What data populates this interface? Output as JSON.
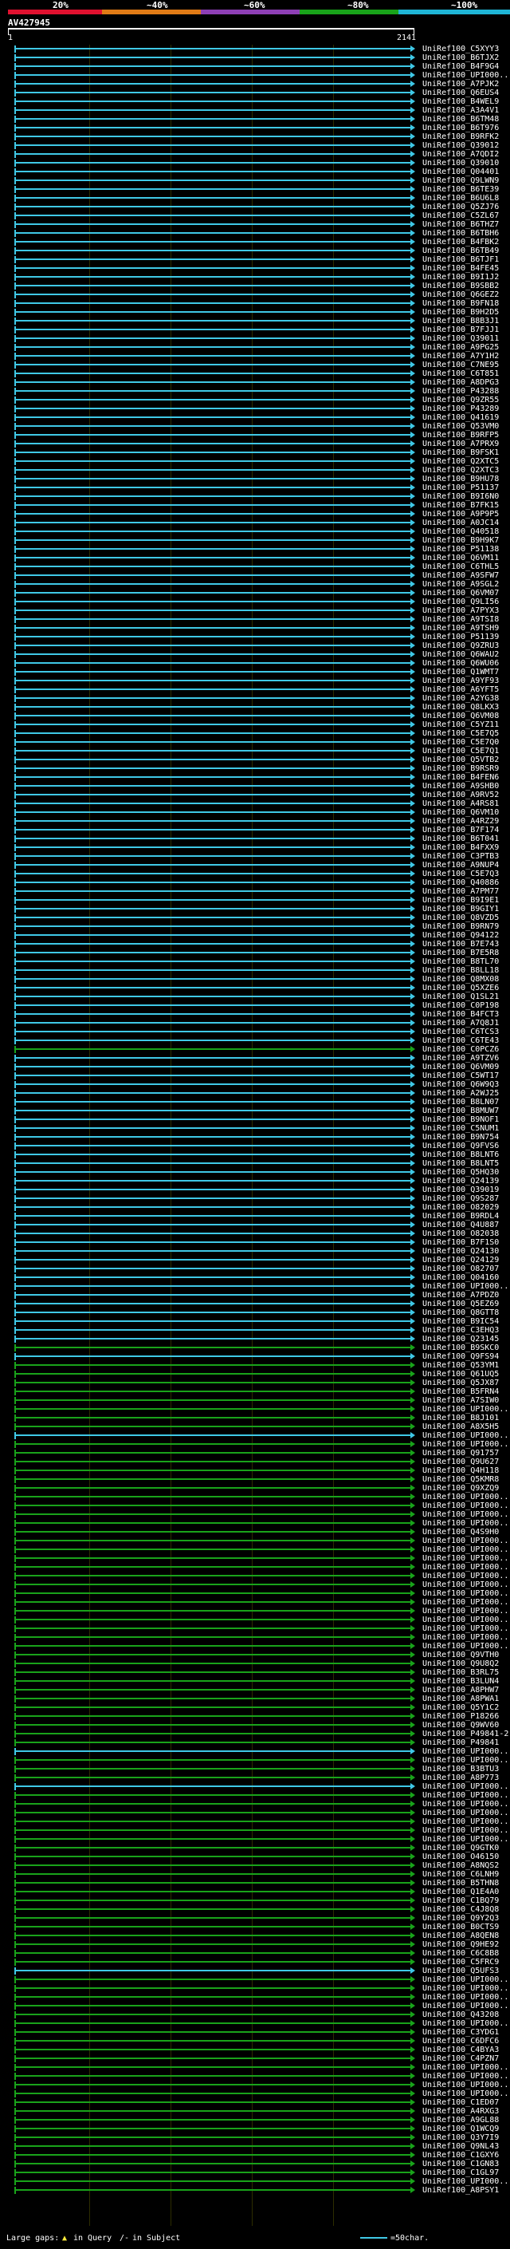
{
  "header": {
    "percent_labels": [
      "20%",
      "~40%",
      "~60%",
      "~80%",
      "~100%"
    ],
    "percent_colors": [
      "#e0112f",
      "#e07b16",
      "#8e3fb5",
      "#19a31a",
      "#1fb5d6"
    ],
    "query_name": "AV427945",
    "ruler_start": "1",
    "ruler_end": "2141"
  },
  "hits": [
    {
      "name": "UniRef100_C5XYY3",
      "color": "#3fc8e6"
    },
    {
      "name": "UniRef100_B6TJX2",
      "color": "#3fc8e6"
    },
    {
      "name": "UniRef100_B4F9G4",
      "color": "#3fc8e6"
    },
    {
      "name": "UniRef100_UPI000...",
      "color": "#3fc8e6"
    },
    {
      "name": "UniRef100_A7PJK2",
      "color": "#3fc8e6"
    },
    {
      "name": "UniRef100_Q6EUS4",
      "color": "#3fc8e6"
    },
    {
      "name": "UniRef100_B4WEL9",
      "color": "#3fc8e6"
    },
    {
      "name": "UniRef100_A3A4V1",
      "color": "#3fc8e6"
    },
    {
      "name": "UniRef100_B6TM48",
      "color": "#3fc8e6"
    },
    {
      "name": "UniRef100_B6T976",
      "color": "#3fc8e6"
    },
    {
      "name": "UniRef100_B9RFK2",
      "color": "#3fc8e6"
    },
    {
      "name": "UniRef100_Q39012",
      "color": "#3fc8e6"
    },
    {
      "name": "UniRef100_A7QDI2",
      "color": "#3fc8e6"
    },
    {
      "name": "UniRef100_Q39010",
      "color": "#3fc8e6"
    },
    {
      "name": "UniRef100_Q04401",
      "color": "#3fc8e6"
    },
    {
      "name": "UniRef100_Q9LWN9",
      "color": "#3fc8e6"
    },
    {
      "name": "UniRef100_B6TE39",
      "color": "#3fc8e6"
    },
    {
      "name": "UniRef100_B6U6L8",
      "color": "#3fc8e6"
    },
    {
      "name": "UniRef100_Q5ZJ76",
      "color": "#3fc8e6"
    },
    {
      "name": "UniRef100_C5ZL67",
      "color": "#3fc8e6"
    },
    {
      "name": "UniRef100_B6THZ7",
      "color": "#3fc8e6"
    },
    {
      "name": "UniRef100_B6TBH6",
      "color": "#3fc8e6"
    },
    {
      "name": "UniRef100_B4FBK2",
      "color": "#3fc8e6"
    },
    {
      "name": "UniRef100_B6TB49",
      "color": "#3fc8e6"
    },
    {
      "name": "UniRef100_B6TJF1",
      "color": "#3fc8e6"
    },
    {
      "name": "UniRef100_B4FE45",
      "color": "#3fc8e6"
    },
    {
      "name": "UniRef100_B9I1J2",
      "color": "#3fc8e6"
    },
    {
      "name": "UniRef100_B9SBB2",
      "color": "#3fc8e6"
    },
    {
      "name": "UniRef100_Q6GEZ2",
      "color": "#3fc8e6"
    },
    {
      "name": "UniRef100_B9FN18",
      "color": "#3fc8e6"
    },
    {
      "name": "UniRef100_B9H2D5",
      "color": "#3fc8e6"
    },
    {
      "name": "UniRef100_B8B3J1",
      "color": "#3fc8e6"
    },
    {
      "name": "UniRef100_B7FJJ1",
      "color": "#3fc8e6"
    },
    {
      "name": "UniRef100_Q39011",
      "color": "#3fc8e6"
    },
    {
      "name": "UniRef100_A9PG25",
      "color": "#3fc8e6"
    },
    {
      "name": "UniRef100_A7Y1H2",
      "color": "#3fc8e6"
    },
    {
      "name": "UniRef100_C7NE95",
      "color": "#3fc8e6"
    },
    {
      "name": "UniRef100_C6T851",
      "color": "#3fc8e6"
    },
    {
      "name": "UniRef100_A8DPG3",
      "color": "#3fc8e6"
    },
    {
      "name": "UniRef100_P43288",
      "color": "#3fc8e6"
    },
    {
      "name": "UniRef100_Q9ZR55",
      "color": "#3fc8e6"
    },
    {
      "name": "UniRef100_P43289",
      "color": "#3fc8e6"
    },
    {
      "name": "UniRef100_Q41619",
      "color": "#3fc8e6"
    },
    {
      "name": "UniRef100_Q53VM0",
      "color": "#3fc8e6"
    },
    {
      "name": "UniRef100_B9RFP5",
      "color": "#3fc8e6"
    },
    {
      "name": "UniRef100_A7PRX9",
      "color": "#3fc8e6"
    },
    {
      "name": "UniRef100_B9FSK1",
      "color": "#3fc8e6"
    },
    {
      "name": "UniRef100_Q2XTC5",
      "color": "#3fc8e6"
    },
    {
      "name": "UniRef100_Q2XTC3",
      "color": "#3fc8e6"
    },
    {
      "name": "UniRef100_B9HU78",
      "color": "#3fc8e6"
    },
    {
      "name": "UniRef100_P51137",
      "color": "#3fc8e6"
    },
    {
      "name": "UniRef100_B9I6N0",
      "color": "#3fc8e6"
    },
    {
      "name": "UniRef100_B7FK15",
      "color": "#3fc8e6"
    },
    {
      "name": "UniRef100_A9P9P5",
      "color": "#3fc8e6"
    },
    {
      "name": "UniRef100_A0JC14",
      "color": "#3fc8e6"
    },
    {
      "name": "UniRef100_Q40518",
      "color": "#3fc8e6"
    },
    {
      "name": "UniRef100_B9H9K7",
      "color": "#3fc8e6"
    },
    {
      "name": "UniRef100_P51138",
      "color": "#3fc8e6"
    },
    {
      "name": "UniRef100_Q6VM11",
      "color": "#3fc8e6"
    },
    {
      "name": "UniRef100_C6THL5",
      "color": "#3fc8e6"
    },
    {
      "name": "UniRef100_A9SFW7",
      "color": "#3fc8e6"
    },
    {
      "name": "UniRef100_A9SGL2",
      "color": "#3fc8e6"
    },
    {
      "name": "UniRef100_Q6VM07",
      "color": "#3fc8e6"
    },
    {
      "name": "UniRef100_Q9LI56",
      "color": "#3fc8e6"
    },
    {
      "name": "UniRef100_A7PYX3",
      "color": "#3fc8e6"
    },
    {
      "name": "UniRef100_A9TSI8",
      "color": "#3fc8e6"
    },
    {
      "name": "UniRef100_A9TSH9",
      "color": "#3fc8e6"
    },
    {
      "name": "UniRef100_P51139",
      "color": "#3fc8e6"
    },
    {
      "name": "UniRef100_Q9ZRU3",
      "color": "#3fc8e6"
    },
    {
      "name": "UniRef100_Q6WAU2",
      "color": "#3fc8e6"
    },
    {
      "name": "UniRef100_Q6WU06",
      "color": "#3fc8e6"
    },
    {
      "name": "UniRef100_Q1WMT7",
      "color": "#3fc8e6"
    },
    {
      "name": "UniRef100_A9YF93",
      "color": "#3fc8e6"
    },
    {
      "name": "UniRef100_A6YFT5",
      "color": "#3fc8e6"
    },
    {
      "name": "UniRef100_A2YG38",
      "color": "#3fc8e6"
    },
    {
      "name": "UniRef100_Q8LKX3",
      "color": "#3fc8e6"
    },
    {
      "name": "UniRef100_Q6VM08",
      "color": "#3fc8e6"
    },
    {
      "name": "UniRef100_C5YZ11",
      "color": "#3fc8e6"
    },
    {
      "name": "UniRef100_C5E7Q5",
      "color": "#3fc8e6"
    },
    {
      "name": "UniRef100_C5E7Q0",
      "color": "#3fc8e6"
    },
    {
      "name": "UniRef100_C5E7Q1",
      "color": "#3fc8e6"
    },
    {
      "name": "UniRef100_Q5VTB2",
      "color": "#3fc8e6"
    },
    {
      "name": "UniRef100_B9RSR9",
      "color": "#3fc8e6"
    },
    {
      "name": "UniRef100_B4FEN6",
      "color": "#3fc8e6"
    },
    {
      "name": "UniRef100_A9SHB0",
      "color": "#3fc8e6"
    },
    {
      "name": "UniRef100_A9RV52",
      "color": "#3fc8e6"
    },
    {
      "name": "UniRef100_A4RS81",
      "color": "#3fc8e6"
    },
    {
      "name": "UniRef100_Q6VM10",
      "color": "#3fc8e6"
    },
    {
      "name": "UniRef100_A4RZ29",
      "color": "#3fc8e6"
    },
    {
      "name": "UniRef100_B7F174",
      "color": "#3fc8e6"
    },
    {
      "name": "UniRef100_B6T041",
      "color": "#3fc8e6"
    },
    {
      "name": "UniRef100_B4FXX9",
      "color": "#3fc8e6"
    },
    {
      "name": "UniRef100_C3PTB3",
      "color": "#3fc8e6"
    },
    {
      "name": "UniRef100_A9NUP4",
      "color": "#3fc8e6"
    },
    {
      "name": "UniRef100_C5E7Q3",
      "color": "#3fc8e6"
    },
    {
      "name": "UniRef100_Q40886",
      "color": "#3fc8e6"
    },
    {
      "name": "UniRef100_A7PM77",
      "color": "#3fc8e6"
    },
    {
      "name": "UniRef100_B9I9E1",
      "color": "#3fc8e6"
    },
    {
      "name": "UniRef100_B9GIY1",
      "color": "#3fc8e6"
    },
    {
      "name": "UniRef100_Q8VZD5",
      "color": "#3fc8e6"
    },
    {
      "name": "UniRef100_B9RN79",
      "color": "#3fc8e6"
    },
    {
      "name": "UniRef100_Q94122",
      "color": "#3fc8e6"
    },
    {
      "name": "UniRef100_B7E743",
      "color": "#3fc8e6"
    },
    {
      "name": "UniRef100_B7E5R8",
      "color": "#3fc8e6"
    },
    {
      "name": "UniRef100_B8TL70",
      "color": "#3fc8e6"
    },
    {
      "name": "UniRef100_B8LL18",
      "color": "#3fc8e6"
    },
    {
      "name": "UniRef100_Q8MX08",
      "color": "#3fc8e6"
    },
    {
      "name": "UniRef100_Q5XZE6",
      "color": "#3fc8e6"
    },
    {
      "name": "UniRef100_Q1SL21",
      "color": "#3fc8e6"
    },
    {
      "name": "UniRef100_C0P198",
      "color": "#3fc8e6"
    },
    {
      "name": "UniRef100_B4FCT3",
      "color": "#3fc8e6"
    },
    {
      "name": "UniRef100_A7Q8J1",
      "color": "#3fc8e6"
    },
    {
      "name": "UniRef100_C6TCS3",
      "color": "#3fc8e6"
    },
    {
      "name": "UniRef100_C6TE43",
      "color": "#3fc8e6"
    },
    {
      "name": "UniRef100_C0PCZ6",
      "color": "#19a31a"
    },
    {
      "name": "UniRef100_A9TZV6",
      "color": "#3fc8e6"
    },
    {
      "name": "UniRef100_Q6VM09",
      "color": "#3fc8e6"
    },
    {
      "name": "UniRef100_C5WT17",
      "color": "#3fc8e6"
    },
    {
      "name": "UniRef100_Q6W9Q3",
      "color": "#3fc8e6"
    },
    {
      "name": "UniRef100_A2WJ25",
      "color": "#3fc8e6"
    },
    {
      "name": "UniRef100_B8LN07",
      "color": "#3fc8e6"
    },
    {
      "name": "UniRef100_B8MUW7",
      "color": "#3fc8e6"
    },
    {
      "name": "UniRef100_B9NOF1",
      "color": "#3fc8e6"
    },
    {
      "name": "UniRef100_C5NUM1",
      "color": "#3fc8e6"
    },
    {
      "name": "UniRef100_B9N754",
      "color": "#3fc8e6"
    },
    {
      "name": "UniRef100_Q9FVS6",
      "color": "#3fc8e6"
    },
    {
      "name": "UniRef100_B8LNT6",
      "color": "#3fc8e6"
    },
    {
      "name": "UniRef100_B8LNT5",
      "color": "#3fc8e6"
    },
    {
      "name": "UniRef100_Q5HQ30",
      "color": "#3fc8e6"
    },
    {
      "name": "UniRef100_Q24139",
      "color": "#3fc8e6"
    },
    {
      "name": "UniRef100_Q39019",
      "color": "#3fc8e6"
    },
    {
      "name": "UniRef100_Q9S287",
      "color": "#3fc8e6"
    },
    {
      "name": "UniRef100_O82029",
      "color": "#3fc8e6"
    },
    {
      "name": "UniRef100_B9RDL4",
      "color": "#3fc8e6"
    },
    {
      "name": "UniRef100_Q4U887",
      "color": "#3fc8e6"
    },
    {
      "name": "UniRef100_O82038",
      "color": "#3fc8e6"
    },
    {
      "name": "UniRef100_B7F1S0",
      "color": "#3fc8e6"
    },
    {
      "name": "UniRef100_Q24130",
      "color": "#3fc8e6"
    },
    {
      "name": "UniRef100_Q24129",
      "color": "#3fc8e6"
    },
    {
      "name": "UniRef100_O82707",
      "color": "#3fc8e6"
    },
    {
      "name": "UniRef100_Q04160",
      "color": "#3fc8e6"
    },
    {
      "name": "UniRef100_UPI000...",
      "color": "#3fc8e6"
    },
    {
      "name": "UniRef100_A7PDZ0",
      "color": "#3fc8e6"
    },
    {
      "name": "UniRef100_Q5EZ69",
      "color": "#3fc8e6"
    },
    {
      "name": "UniRef100_Q8GTT8",
      "color": "#3fc8e6"
    },
    {
      "name": "UniRef100_B9IC54",
      "color": "#3fc8e6"
    },
    {
      "name": "UniRef100_C3EHQ3",
      "color": "#3fc8e6"
    },
    {
      "name": "UniRef100_Q23145",
      "color": "#3fc8e6"
    },
    {
      "name": "UniRef100_B9SKC0",
      "color": "#19a31a"
    },
    {
      "name": "UniRef100_Q9FS94",
      "color": "#3fc8e6"
    },
    {
      "name": "UniRef100_Q53YM1",
      "color": "#19a31a"
    },
    {
      "name": "UniRef100_Q61UQ5",
      "color": "#19a31a"
    },
    {
      "name": "UniRef100_Q5JX87",
      "color": "#19a31a"
    },
    {
      "name": "UniRef100_B5FRN4",
      "color": "#19a31a"
    },
    {
      "name": "UniRef100_A7SIW0",
      "color": "#19a31a"
    },
    {
      "name": "UniRef100_UPI000...",
      "color": "#19a31a"
    },
    {
      "name": "UniRef100_B8J101",
      "color": "#19a31a"
    },
    {
      "name": "UniRef100_A8X5H5",
      "color": "#19a31a"
    },
    {
      "name": "UniRef100_UPI000...",
      "color": "#3fc8e6"
    },
    {
      "name": "UniRef100_UPI000...",
      "color": "#19a31a"
    },
    {
      "name": "UniRef100_Q91757",
      "color": "#19a31a"
    },
    {
      "name": "UniRef100_Q9U627",
      "color": "#19a31a"
    },
    {
      "name": "UniRef100_Q4H118",
      "color": "#19a31a"
    },
    {
      "name": "UniRef100_Q5KMR8",
      "color": "#19a31a"
    },
    {
      "name": "UniRef100_Q9XZQ9",
      "color": "#19a31a"
    },
    {
      "name": "UniRef100_UPI000...",
      "color": "#19a31a"
    },
    {
      "name": "UniRef100_UPI000...",
      "color": "#19a31a"
    },
    {
      "name": "UniRef100_UPI000...",
      "color": "#19a31a"
    },
    {
      "name": "UniRef100_UPI000...",
      "color": "#19a31a"
    },
    {
      "name": "UniRef100_Q4S9H0",
      "color": "#19a31a"
    },
    {
      "name": "UniRef100_UPI000...",
      "color": "#19a31a"
    },
    {
      "name": "UniRef100_UPI000...",
      "color": "#19a31a"
    },
    {
      "name": "UniRef100_UPI000...",
      "color": "#19a31a"
    },
    {
      "name": "UniRef100_UPI000...",
      "color": "#19a31a"
    },
    {
      "name": "UniRef100_UPI000...",
      "color": "#19a31a"
    },
    {
      "name": "UniRef100_UPI000...",
      "color": "#19a31a"
    },
    {
      "name": "UniRef100_UPI000...",
      "color": "#19a31a"
    },
    {
      "name": "UniRef100_UPI000...",
      "color": "#19a31a"
    },
    {
      "name": "UniRef100_UPI000...",
      "color": "#19a31a"
    },
    {
      "name": "UniRef100_UPI000...",
      "color": "#19a31a"
    },
    {
      "name": "UniRef100_UPI000...",
      "color": "#19a31a"
    },
    {
      "name": "UniRef100_UPI000...",
      "color": "#19a31a"
    },
    {
      "name": "UniRef100_UPI000...",
      "color": "#19a31a"
    },
    {
      "name": "UniRef100_Q9VTH0",
      "color": "#19a31a"
    },
    {
      "name": "UniRef100_Q9U8Q2",
      "color": "#19a31a"
    },
    {
      "name": "UniRef100_B3RL75",
      "color": "#19a31a"
    },
    {
      "name": "UniRef100_B3LUN4",
      "color": "#19a31a"
    },
    {
      "name": "UniRef100_A8PHW7",
      "color": "#19a31a"
    },
    {
      "name": "UniRef100_A8PWA1",
      "color": "#19a31a"
    },
    {
      "name": "UniRef100_Q5Y1C2",
      "color": "#19a31a"
    },
    {
      "name": "UniRef100_P18266",
      "color": "#19a31a"
    },
    {
      "name": "UniRef100_Q9WV60",
      "color": "#19a31a"
    },
    {
      "name": "UniRef100_P49841-2",
      "color": "#19a31a"
    },
    {
      "name": "UniRef100_P49841",
      "color": "#19a31a"
    },
    {
      "name": "UniRef100_UPI000...",
      "color": "#3fc8e6"
    },
    {
      "name": "UniRef100_UPI000...",
      "color": "#19a31a"
    },
    {
      "name": "UniRef100_B3BTU3",
      "color": "#19a31a"
    },
    {
      "name": "UniRef100_A8P773",
      "color": "#19a31a"
    },
    {
      "name": "UniRef100_UPI000...",
      "color": "#3fc8e6"
    },
    {
      "name": "UniRef100_UPI000...",
      "color": "#19a31a"
    },
    {
      "name": "UniRef100_UPI000...",
      "color": "#19a31a"
    },
    {
      "name": "UniRef100_UPI000...",
      "color": "#19a31a"
    },
    {
      "name": "UniRef100_UPI000...",
      "color": "#19a31a"
    },
    {
      "name": "UniRef100_UPI000...",
      "color": "#19a31a"
    },
    {
      "name": "UniRef100_UPI000...",
      "color": "#19a31a"
    },
    {
      "name": "UniRef100_Q9GTK0",
      "color": "#19a31a"
    },
    {
      "name": "UniRef100_O46150",
      "color": "#19a31a"
    },
    {
      "name": "UniRef100_A8NQS2",
      "color": "#19a31a"
    },
    {
      "name": "UniRef100_C6LNH9",
      "color": "#19a31a"
    },
    {
      "name": "UniRef100_B5THN8",
      "color": "#19a31a"
    },
    {
      "name": "UniRef100_Q1E4A0",
      "color": "#19a31a"
    },
    {
      "name": "UniRef100_C1BQ79",
      "color": "#19a31a"
    },
    {
      "name": "UniRef100_C4J8Q8",
      "color": "#19a31a"
    },
    {
      "name": "UniRef100_Q9Y2Q3",
      "color": "#19a31a"
    },
    {
      "name": "UniRef100_B0CTS9",
      "color": "#19a31a"
    },
    {
      "name": "UniRef100_A8QEN8",
      "color": "#19a31a"
    },
    {
      "name": "UniRef100_Q9HE92",
      "color": "#19a31a"
    },
    {
      "name": "UniRef100_C6C8B8",
      "color": "#19a31a"
    },
    {
      "name": "UniRef100_C5FRC9",
      "color": "#19a31a"
    },
    {
      "name": "UniRef100_Q5UFS3",
      "color": "#3fc8e6"
    },
    {
      "name": "UniRef100_UPI000...",
      "color": "#19a31a"
    },
    {
      "name": "UniRef100_UPI000...",
      "color": "#19a31a"
    },
    {
      "name": "UniRef100_UPI000...",
      "color": "#19a31a"
    },
    {
      "name": "UniRef100_UPI000...",
      "color": "#19a31a"
    },
    {
      "name": "UniRef100_Q43208",
      "color": "#19a31a"
    },
    {
      "name": "UniRef100_UPI000...",
      "color": "#19a31a"
    },
    {
      "name": "UniRef100_C3YDG1",
      "color": "#19a31a"
    },
    {
      "name": "UniRef100_C6DFC6",
      "color": "#19a31a"
    },
    {
      "name": "UniRef100_C4BYA3",
      "color": "#19a31a"
    },
    {
      "name": "UniRef100_C4PZN7",
      "color": "#19a31a"
    },
    {
      "name": "UniRef100_UPI000...",
      "color": "#19a31a"
    },
    {
      "name": "UniRef100_UPI000...",
      "color": "#19a31a"
    },
    {
      "name": "UniRef100_UPI000...",
      "color": "#19a31a"
    },
    {
      "name": "UniRef100_UPI000...",
      "color": "#19a31a"
    },
    {
      "name": "UniRef100_C1ED07",
      "color": "#19a31a"
    },
    {
      "name": "UniRef100_A4RXG3",
      "color": "#19a31a"
    },
    {
      "name": "UniRef100_A9GL88",
      "color": "#19a31a"
    },
    {
      "name": "UniRef100_Q1WCQ9",
      "color": "#19a31a"
    },
    {
      "name": "UniRef100_Q3Y7I9",
      "color": "#19a31a"
    },
    {
      "name": "UniRef100_Q9NL43",
      "color": "#19a31a"
    },
    {
      "name": "UniRef100_C1GXY6",
      "color": "#19a31a"
    },
    {
      "name": "UniRef100_C1GN83",
      "color": "#19a31a"
    },
    {
      "name": "UniRef100_C1GL97",
      "color": "#19a31a"
    },
    {
      "name": "UniRef100_UPI000...",
      "color": "#19a31a"
    },
    {
      "name": "UniRef100_A8PSY1",
      "color": "#19a31a"
    }
  ],
  "legend": {
    "label": "Large gaps:",
    "query_gap": "in Query",
    "subject_gap": "in Subject",
    "scale": "=50char."
  }
}
